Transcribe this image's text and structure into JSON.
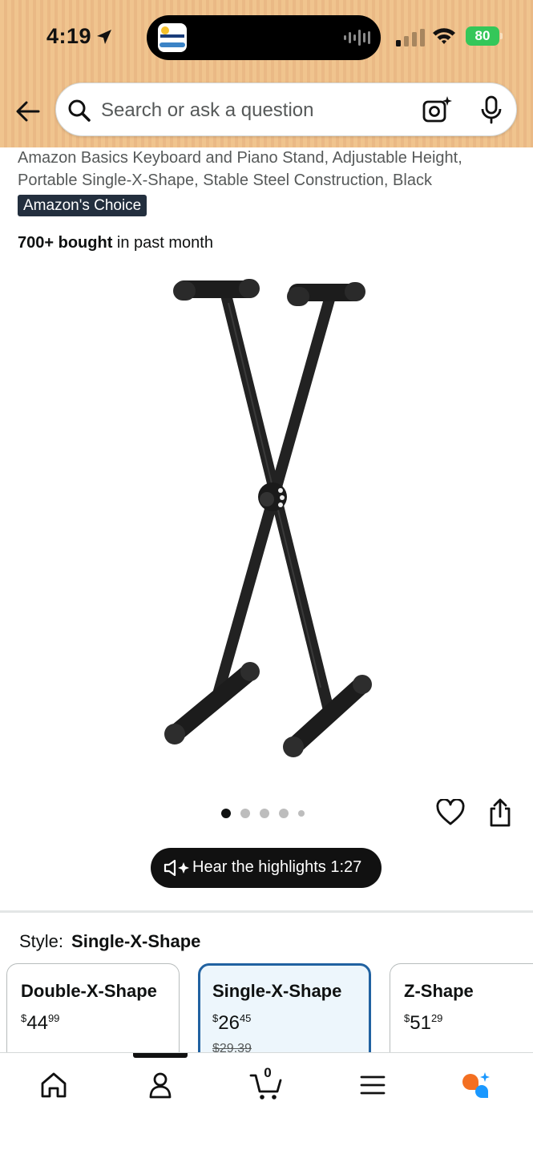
{
  "status_bar": {
    "time": "4:19",
    "battery": "80"
  },
  "search": {
    "placeholder": "Search or ask a question"
  },
  "product": {
    "title": "Amazon Basics Keyboard and Piano Stand, Adjustable Height, Portable Single-X-Shape, Stable Steel Construction, Black",
    "badge": "Amazon's Choice",
    "bought_bold": "700+ bought",
    "bought_rest": " in past month",
    "image_count": 5,
    "active_image_index": 0
  },
  "audio": {
    "label": "Hear the highlights 1:27"
  },
  "style": {
    "label": "Style:",
    "selected": "Single-X-Shape"
  },
  "variants": [
    {
      "name": "Double-X-Shape",
      "symbol": "$",
      "whole": "44",
      "fraction": "99",
      "list_price": "",
      "selected": false
    },
    {
      "name": "Single-X-Shape",
      "symbol": "$",
      "whole": "26",
      "fraction": "45",
      "list_price": "$29.39",
      "selected": true
    },
    {
      "name": "Z-Shape",
      "symbol": "$",
      "whole": "51",
      "fraction": "29",
      "list_price": "",
      "selected": false
    }
  ],
  "bottom_nav": {
    "cart_count": "0",
    "items": [
      "home-icon",
      "account-icon",
      "cart-icon",
      "menu-icon",
      "rufus-icon"
    ]
  },
  "colors": {
    "header_bg": "#f0c48e",
    "badge_bg": "#232f3e",
    "selected_border": "#2162a1",
    "selected_bg": "#edf6fc",
    "battery": "#34c759"
  }
}
